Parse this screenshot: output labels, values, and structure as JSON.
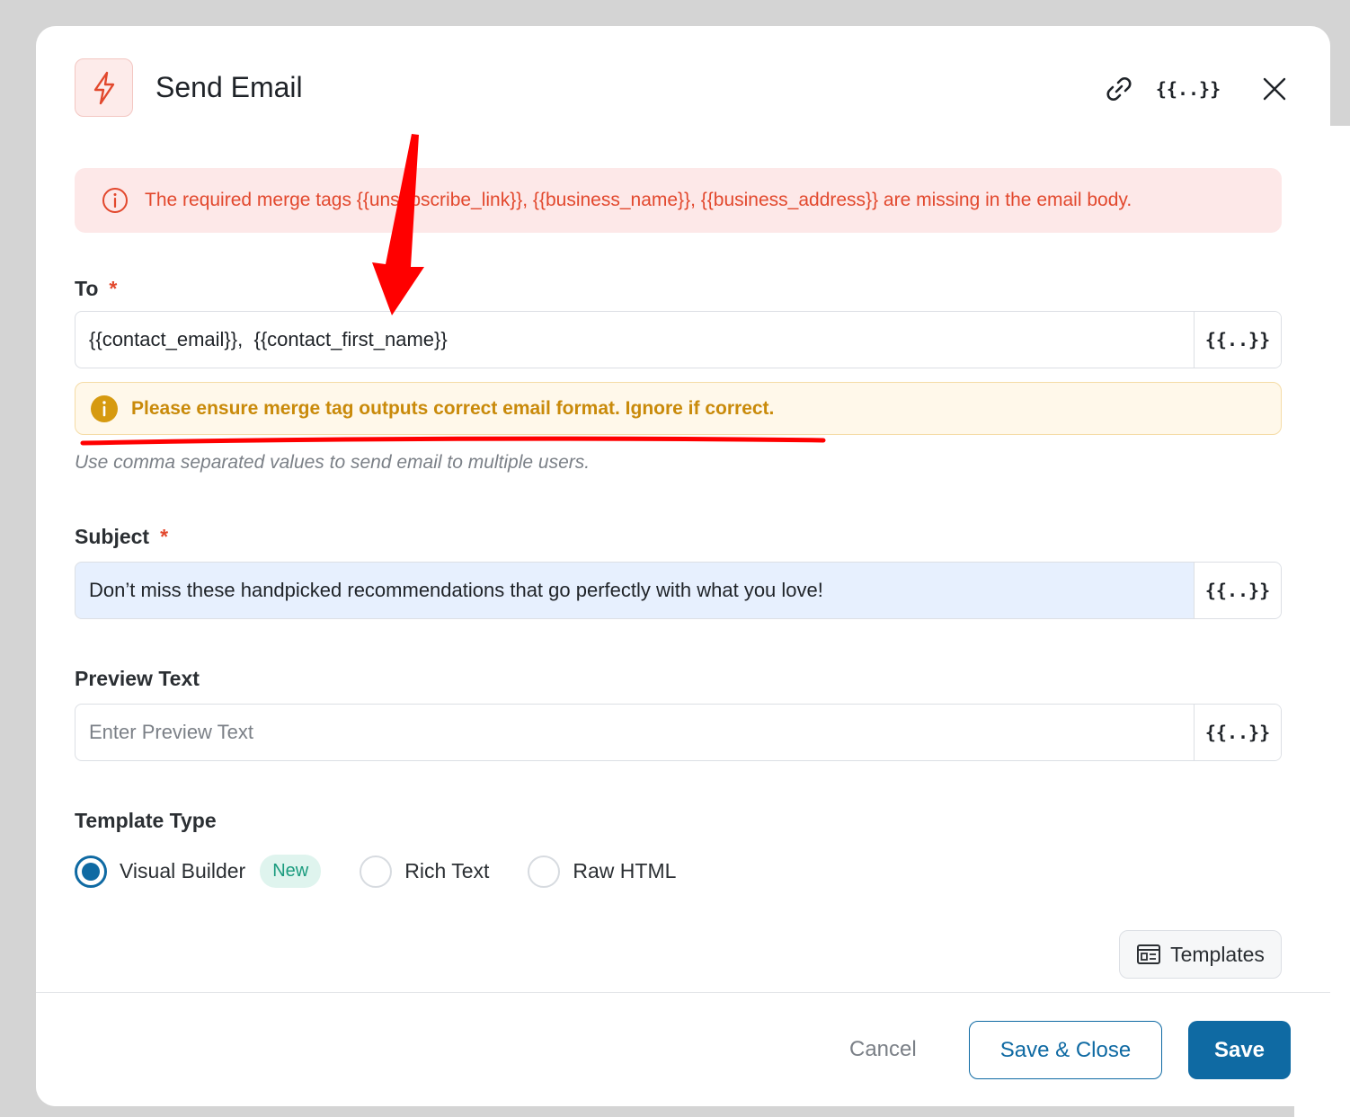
{
  "modal": {
    "title": "Send Email",
    "icons": [
      "lightning-icon",
      "link-icon",
      "merge-tag-icon",
      "close-icon"
    ],
    "merge_tag_symbol": "{{..}}"
  },
  "error_alert": {
    "text": "The required merge tags {{unsubscribe_link}}, {{business_name}}, {{business_address}} are missing in the email body."
  },
  "to_field": {
    "label": "To",
    "required_mark": "*",
    "value": "{{contact_email}},  {{contact_first_name}}",
    "warning": "Please ensure merge tag outputs correct email format. Ignore if correct.",
    "hint": "Use comma separated values to send email to multiple users."
  },
  "subject_field": {
    "label": "Subject",
    "required_mark": "*",
    "value": "Don’t miss these handpicked recommendations that go perfectly with what you love!"
  },
  "preview_field": {
    "label": "Preview Text",
    "placeholder": "Enter Preview Text",
    "value": ""
  },
  "template_type": {
    "label": "Template Type",
    "options": [
      {
        "label": "Visual Builder",
        "selected": true,
        "badge": "New"
      },
      {
        "label": "Rich Text",
        "selected": false
      },
      {
        "label": "Raw HTML",
        "selected": false
      }
    ]
  },
  "templates_button": {
    "label": "Templates"
  },
  "footer": {
    "cancel_label": "Cancel",
    "save_close_label": "Save & Close",
    "save_label": "Save"
  },
  "colors": {
    "primary": "#0f6aa3",
    "error": "#e2482d",
    "warning": "#c98a0a",
    "annotation": "#ff0000"
  }
}
